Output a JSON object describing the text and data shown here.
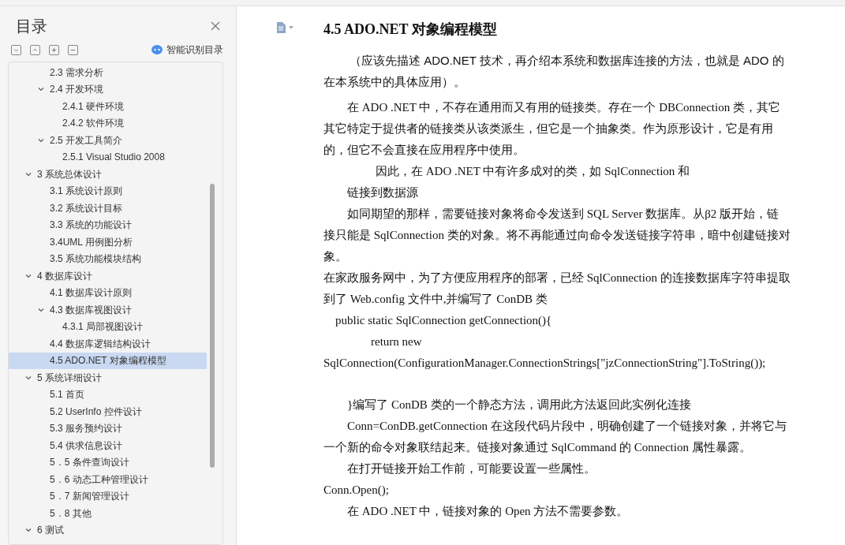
{
  "toc": {
    "title": "目录",
    "smart_button": "智能识别目录",
    "continued": [
      {
        "label": "2.3  需求分析",
        "selected": false
      },
      {
        "label": "2.4  开发环境",
        "expanded": true,
        "selected": false,
        "children": [
          {
            "label": "2.4.1 硬件环境",
            "selected": false
          },
          {
            "label": "2.4.2 软件环境",
            "selected": false
          }
        ]
      },
      {
        "label": "2.5 开发工具简介",
        "expanded": true,
        "selected": false,
        "children": [
          {
            "label": "2.5.1 Visual Studio 2008",
            "selected": false
          }
        ]
      }
    ],
    "items": [
      {
        "label": "3 系统总体设计",
        "expanded": true,
        "selected": false,
        "children": [
          {
            "label": "3.1 系统设计原则",
            "selected": false
          },
          {
            "label": "3.2 系统设计目标",
            "selected": false
          },
          {
            "label": "3.3 系统的功能设计",
            "selected": false
          },
          {
            "label": "3.4UML 用例图分析",
            "selected": false
          },
          {
            "label": "3.5 系统功能模块结构",
            "selected": false
          }
        ]
      },
      {
        "label": "4 数据库设计",
        "expanded": true,
        "selected": false,
        "children": [
          {
            "label": "4.1 数据库设计原则",
            "selected": false
          },
          {
            "label": "4.3 数据库视图设计",
            "expanded": true,
            "selected": false,
            "children": [
              {
                "label": "4.3.1 局部视图设计",
                "selected": false
              }
            ]
          },
          {
            "label": "4.4 数据库逻辑结构设计",
            "selected": false
          },
          {
            "label": "4.5 ADO.NET  对象编程模型",
            "selected": true
          }
        ]
      },
      {
        "label": "5 系统详细设计",
        "expanded": true,
        "selected": false,
        "children": [
          {
            "label": "5.1 首页",
            "selected": false
          },
          {
            "label": "5.2 UserInfo 控件设计",
            "selected": false
          },
          {
            "label": "5.3  服务预约设计",
            "selected": false
          },
          {
            "label": "5.4 供求信息设计",
            "selected": false
          },
          {
            "label": "5．5 条件查询设计",
            "selected": false
          },
          {
            "label": "5．6 动态工种管理设计",
            "selected": false
          },
          {
            "label": "5．7 新闻管理设计",
            "selected": false
          },
          {
            "label": "5．8  其他",
            "selected": false
          }
        ]
      },
      {
        "label": "6 测试",
        "expanded": true,
        "selected": false
      }
    ]
  },
  "document": {
    "heading": "4.5 ADO.NET  对象编程模型",
    "paragraphs": [
      {
        "kind": "note",
        "text": "（应该先描述 ADO.NET 技术，再介绍本系统和数据库连接的方法，也就是 ADO 的在本系统中的具体应用）。"
      },
      {
        "kind": "indent",
        "text": "在 ADO .NET 中，不存在通用而又有用的链接类。存在一个 DBConnection 类，其它其它特定于提供者的链接类从该类派生，但它是一个抽象类。作为原形设计，它是有用的，但它不会直接在应用程序中使用。"
      },
      {
        "kind": "deep",
        "text": "因此，在 ADO .NET 中有许多成对的类，如 SqlConnection  和"
      },
      {
        "kind": "indent",
        "text": "链接到数据源"
      },
      {
        "kind": "indent",
        "text": "如同期望的那样，需要链接对象将命令发送到 SQL Server 数据库。从β2 版开始，链接只能是 SqlConnection 类的对象。将不再能通过向命令发送链接字符串，暗中创建链接对象。"
      },
      {
        "kind": "plain",
        "text": "在家政服务网中，为了方便应用程序的部署，已经 SqlConnection 的连接数据库字符串提取到了 Web.config 文件中,并编写了 ConDB 类"
      },
      {
        "kind": "code1",
        "text": "public static SqlConnection getConnection(){"
      },
      {
        "kind": "code2",
        "text": "return new"
      },
      {
        "kind": "code",
        "text": "SqlConnection(ConfigurationManager.ConnectionStrings[\"jzConnectionString\"].ToString());"
      },
      {
        "kind": "gap",
        "text": "}编写了 ConDB 类的一个静态方法，调用此方法返回此实例化连接"
      },
      {
        "kind": "indent",
        "text": "Conn=ConDB.getConnection    在这段代码片段中，明确创建了一个链接对象，并将它与一个新的命令对象联结起来。链接对象通过 SqlCommand 的 Connection 属性暴露。"
      },
      {
        "kind": "indent",
        "text": " 在打开链接开始工作前，可能要设置一些属性。"
      },
      {
        "kind": "plain",
        "text": "Conn.Open();"
      },
      {
        "kind": "indent",
        "text": "在  ADO .NET 中，链接对象的 Open  方法不需要参数。"
      }
    ]
  }
}
